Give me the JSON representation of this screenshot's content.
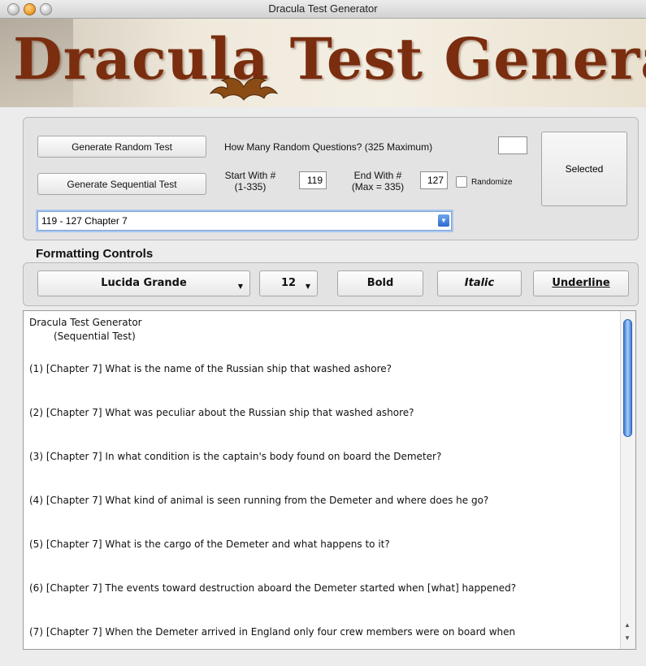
{
  "window": {
    "title": "Dracula Test Generator"
  },
  "banner": {
    "title": "Dracula Test Generator"
  },
  "controls": {
    "generate_random_label": "Generate Random Test",
    "random_questions_label": "How Many Random Questions? (325 Maximum)",
    "random_count_value": "",
    "generate_sequential_label": "Generate Sequential Test",
    "start_with_label_1": "Start With #",
    "start_with_label_2": "(1-335)",
    "start_value": "119",
    "end_with_label_1": "End With #",
    "end_with_label_2": "(Max = 335)",
    "end_value": "127",
    "randomize_label": "Randomize",
    "randomize_checked": false,
    "selected_label": "Selected",
    "chapter_select_value": "119 - 127 Chapter 7"
  },
  "formatting": {
    "heading": "Formatting Controls",
    "font_value": "Lucida Grande",
    "size_value": "12",
    "bold_label": "Bold",
    "italic_label": "Italic",
    "underline_label": "Underline"
  },
  "document": {
    "title": "Dracula Test Generator",
    "subtitle": "(Sequential Test)",
    "questions": [
      "(1)  [Chapter 7] What is the name of the Russian ship that washed ashore?",
      "(2)  [Chapter 7] What was peculiar about the Russian ship that washed ashore?",
      "(3)  [Chapter 7] In what condition is the captain's body found on board the Demeter?",
      "(4)  [Chapter 7] What kind of animal is seen running from the Demeter and where does he go?",
      "(5)  [Chapter 7] What is the cargo of the Demeter and what happens to it?",
      "(6)  [Chapter 7] The events toward destruction aboard the Demeter started when [what] happened?",
      "(7)  [Chapter 7] When the Demeter arrived in England only four crew members were on board when"
    ]
  }
}
